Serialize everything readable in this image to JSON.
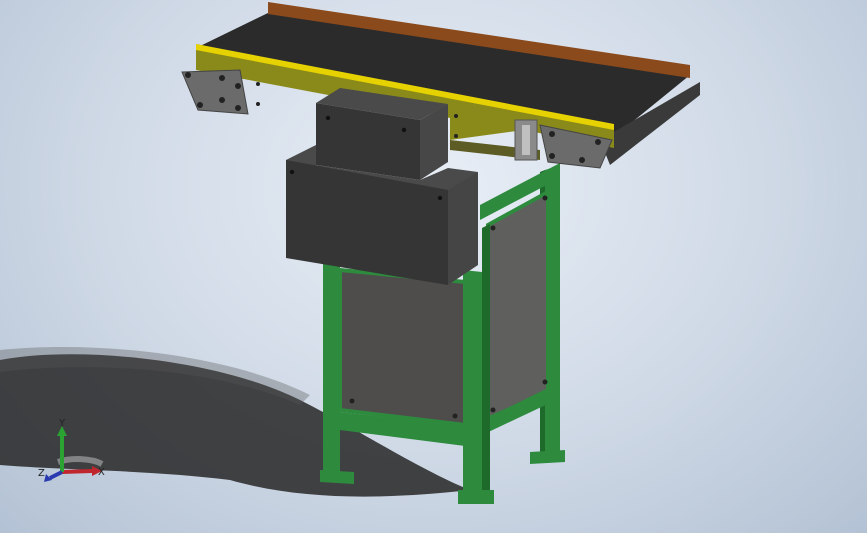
{
  "viewport": {
    "background_top": "#e8eef6",
    "background_bottom": "#b3c2d4"
  },
  "model": {
    "frame_color": "#2e8b3e",
    "frame_dark": "#1d6a2b",
    "panel_color": "#5a5a58",
    "housing_color": "#3c3c3c",
    "side_rail_color": "#8a8a1a",
    "belt_color": "#2b2b2b",
    "belt_edge_color": "#8b4a1c",
    "end_plate_color": "#6b6b6b",
    "yellow_stripe": "#e6d200",
    "shadow_color": "#2a2a2a"
  },
  "triad": {
    "x_label": "X",
    "y_label": "Y",
    "z_label": "Z",
    "x_color": "#c0262e",
    "y_color": "#2aa332",
    "z_color": "#2a3bb0"
  }
}
